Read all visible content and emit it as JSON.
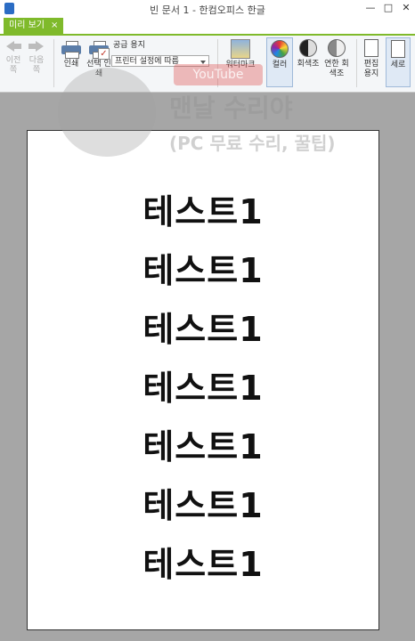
{
  "window": {
    "title": "빈 문서 1 - 한컴오피스 한글"
  },
  "tab": {
    "label": "미리 보기",
    "close": "×"
  },
  "ribbon": {
    "prev_label": "이전 쪽",
    "next_label": "다음 쪽",
    "print_label": "인쇄",
    "select_print_label": "선택 인쇄",
    "paper_label": "공급 용지",
    "printer_setting": "프린터 설정에 따름",
    "watermark_label": "워터마크",
    "color_label": "컬러",
    "gray_label": "회색조",
    "light_gray_label": "연한 회색조",
    "edit_paper_label": "편집 용지",
    "portrait_label": "세로"
  },
  "document": {
    "lines": [
      "테스트1",
      "테스트1",
      "테스트1",
      "테스트1",
      "테스트1",
      "테스트1",
      "테스트1"
    ]
  },
  "overlay": {
    "youtube": "YouTube",
    "channel": "맨날 수리야",
    "subtitle": "(PC 무료 수리, 꿀팁)"
  },
  "colors": {
    "accent": "#7fba2b",
    "app_blue": "#2b6cc4"
  }
}
